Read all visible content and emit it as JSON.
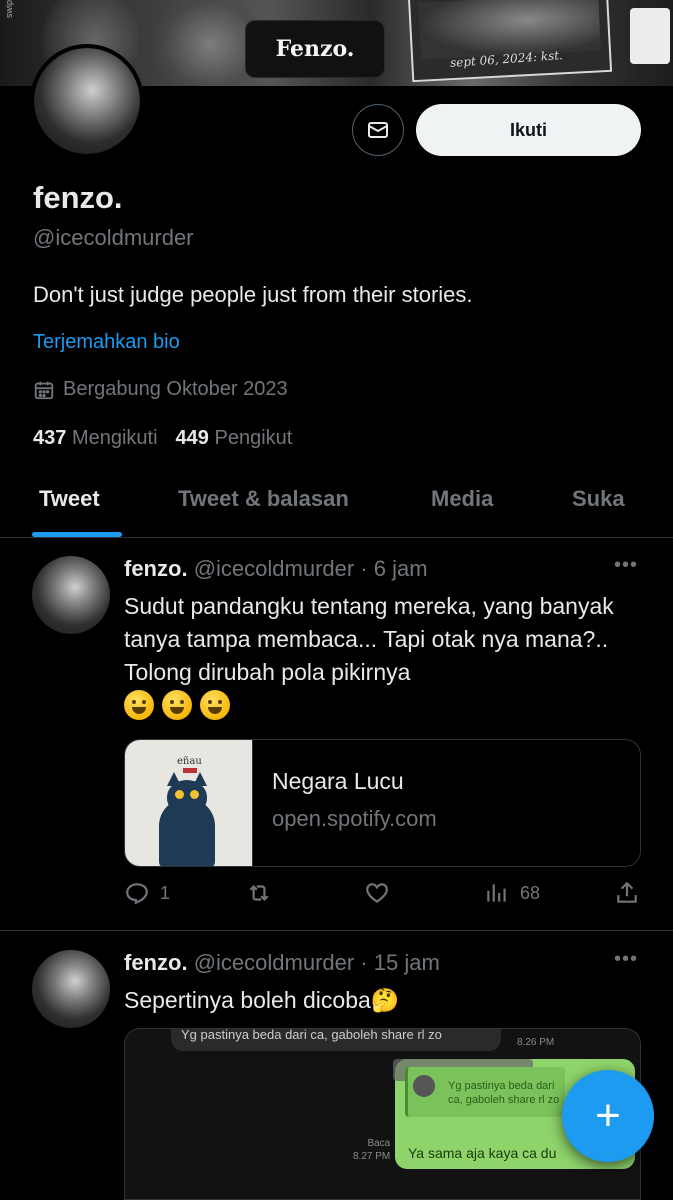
{
  "banner": {
    "brand": "Fenzo.",
    "date_text": "sept 06, 2024: kst.",
    "side_text": "swipe and lets"
  },
  "profile": {
    "name": "fenzo.",
    "handle": "@icecoldmurder",
    "bio": "Don't just judge people just from their stories.",
    "translate_label": "Terjemahkan bio",
    "joined": "Bergabung Oktober 2023",
    "following_count": "437",
    "following_label": "Mengikuti",
    "followers_count": "449",
    "followers_label": "Pengikut",
    "follow_button": "Ikuti",
    "message_icon": "envelope-icon"
  },
  "tabs": [
    {
      "label": "Tweet",
      "active": true
    },
    {
      "label": "Tweet & balasan",
      "active": false
    },
    {
      "label": "Media",
      "active": false
    },
    {
      "label": "Suka",
      "active": false
    }
  ],
  "tweets": [
    {
      "name": "fenzo.",
      "handle_time": "@icecoldmurder · 6 jam",
      "text": "Sudut pandangku tentang mereka, yang banyak tanya tampa membaca... Tapi otak nya mana?.. Tolong dirubah pola pikirnya",
      "emojis": [
        "grinning-sweat-emoji",
        "face-with-hand-over-mouth-emoji",
        "rolling-laughing-emoji"
      ],
      "card": {
        "title": "Negara Lucu",
        "domain": "open.spotify.com",
        "album_label": "eñau"
      },
      "reply_count": "1",
      "retweet_count": "",
      "like_count": "",
      "view_count": "68"
    },
    {
      "name": "fenzo.",
      "handle_time": "@icecoldmurder · 15 jam",
      "text": "Sepertinya boleh dicoba🤔",
      "media": {
        "top_message": "Yg pastinya beda dari ca, gaboleh share rl zo",
        "top_time": "8.26 PM",
        "quote_text": "Yg pastinya beda dari ca, gaboleh share rl zo",
        "reply_text": "Ya sama aja kaya ca du",
        "read_label": "Baca",
        "read_time": "8.27 PM"
      }
    }
  ],
  "fab": {
    "label": "+"
  },
  "colors": {
    "accent": "#1d9bf0",
    "text": "#e7e9ea",
    "muted": "#71767b",
    "border": "#2f3336",
    "background": "#000000"
  }
}
